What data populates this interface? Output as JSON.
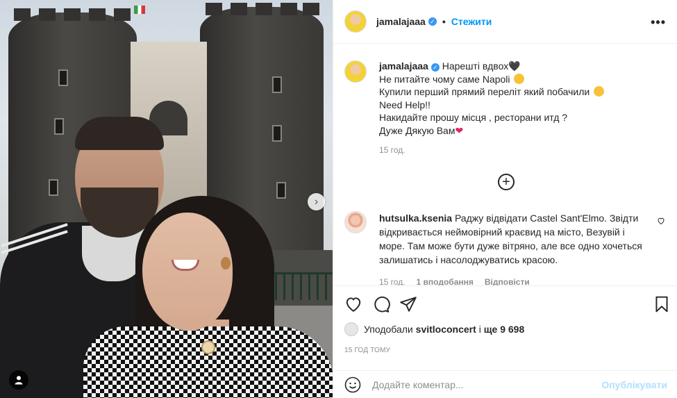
{
  "post": {
    "username": "jamalajaaa",
    "follow_label": "Стежити",
    "more_label": "•••",
    "dot_separator": "•",
    "verified_mark": "✓"
  },
  "caption": {
    "username": "jamalajaaa",
    "lines": [
      "Нарешті вдвох",
      "Не питайте чому саме Napoli",
      "Купили перший прямий переліт який побачили",
      "Need Help!!",
      "Накидайте прошу місця , ресторани итд ?",
      "Дуже Дякую Вам"
    ],
    "black_heart": "🖤",
    "red_heart": "❤",
    "time": "15 год."
  },
  "load_more_icon": "+",
  "comment": {
    "username": "hutsulka.ksenia",
    "text": "Раджу відвідати Castel Sant'Elmo. Звідти відкривається неймовірний краєвид на місто, Везувій і море. Там може бути дуже вітряно, але все одно хочеться залишатись і насолоджуватись красою.",
    "time": "15 год.",
    "likes": "1 вподобання",
    "reply": "Відповісти",
    "like_icon": "heart-outline-icon"
  },
  "likes": {
    "prefix": "Уподобали",
    "user": "svitloconcert",
    "middle": "і",
    "count": "ще 9 698"
  },
  "time_ago": "15 ГОД ТОМУ",
  "add_comment": {
    "placeholder": "Додайте коментар...",
    "publish_label": "Опублікувати"
  },
  "carousel": {
    "next_icon": "›"
  },
  "colors": {
    "link_blue": "#0095f6",
    "publish_disabled": "#b2dffc",
    "heart_red": "#e0245e",
    "muted": "#8e8e8e"
  }
}
